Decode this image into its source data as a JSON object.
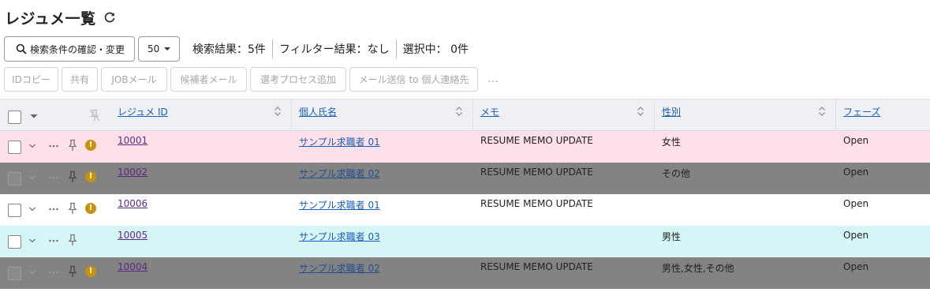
{
  "page": {
    "title": "レジュメ一覧"
  },
  "toolbar": {
    "search_button_label": "検索条件の確認・変更",
    "per_page": "50",
    "search_results": "検索結果：5件",
    "filter_results": "フィルター結果：なし",
    "selected": "選択中： 0件"
  },
  "actions": [
    {
      "label": "IDコピー"
    },
    {
      "label": "共有"
    },
    {
      "label": "JOBメール"
    },
    {
      "label": "候補者メール"
    },
    {
      "label": "選考プロセス追加"
    },
    {
      "label": "メール送信 to 個人連絡先"
    }
  ],
  "more_label": "…",
  "columns": [
    {
      "label": "レジュメ ID"
    },
    {
      "label": "個人氏名"
    },
    {
      "label": "メモ"
    },
    {
      "label": "性別"
    },
    {
      "label": "フェーズ"
    }
  ],
  "rows": [
    {
      "id": "10001",
      "name": "サンプル求職者 01",
      "memo": "RESUME MEMO UPDATE",
      "gender": "女性",
      "phase": "Open",
      "alert": true,
      "color": "pink"
    },
    {
      "id": "10002",
      "name": "サンプル求職者 02",
      "memo": "RESUME MEMO UPDATE",
      "gender": "その他",
      "phase": "Open",
      "alert": true,
      "color": "gray"
    },
    {
      "id": "10006",
      "name": "サンプル求職者 01",
      "memo": "RESUME MEMO UPDATE",
      "gender": "",
      "phase": "Open",
      "alert": true,
      "color": "white"
    },
    {
      "id": "10005",
      "name": "サンプル求職者 03",
      "memo": "",
      "gender": "男性",
      "phase": "Open",
      "alert": false,
      "color": "cyan"
    },
    {
      "id": "10004",
      "name": "サンプル求職者 02",
      "memo": "RESUME MEMO UPDATE",
      "gender": "男性,女性,その他",
      "phase": "Open",
      "alert": true,
      "color": "gray"
    }
  ],
  "colors": {
    "row_pink": "#fde0e8",
    "row_gray": "#838383",
    "row_white": "#ffffff",
    "row_cyan": "#d6f5f6",
    "link": "#1a5fb4",
    "visited_link": "#5b2b82",
    "alert": "#c89211"
  }
}
